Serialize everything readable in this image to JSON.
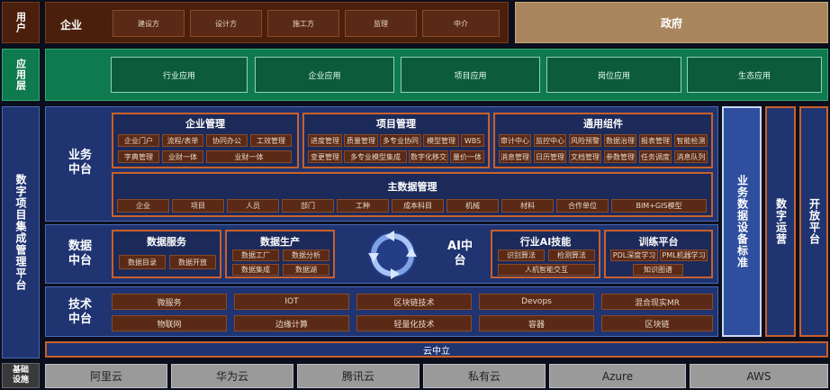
{
  "user_row": {
    "label": "用户",
    "enterprise_label": "企业",
    "roles": [
      "建设方",
      "设计方",
      "施工方",
      "监理",
      "中介"
    ],
    "government_label": "政府"
  },
  "app_row": {
    "label": "应用层",
    "items": [
      "行业应用",
      "企业应用",
      "项目应用",
      "岗位应用",
      "生态应用"
    ]
  },
  "left_label": "数字项目集成管理平台",
  "biz": {
    "label": "业务中台",
    "enterprise_mgmt": {
      "title": "企业管理",
      "cells": [
        "企业门户",
        "流程/表单",
        "协同办公",
        "工效管理",
        "字典管理",
        "业财一体",
        "业财一体"
      ]
    },
    "project_mgmt": {
      "title": "项目管理",
      "cells": [
        "进度管理",
        "质量管理",
        "多专业协同",
        "模型管理",
        "WBS",
        "变更管理",
        "多专业模型集成",
        "数字化移交",
        "量价一体"
      ]
    },
    "common": {
      "title": "通用组件",
      "cells": [
        "审计中心",
        "监控中心",
        "风险预警",
        "数据治理",
        "报表管理",
        "智能检测",
        "消息管理",
        "日历管理",
        "文档管理",
        "参数管理",
        "任务调度",
        "消息队列"
      ]
    },
    "master_data": {
      "title": "主数据管理",
      "cells": [
        "企业",
        "项目",
        "人员",
        "部门",
        "工种",
        "成本科目",
        "机械",
        "材料",
        "合作单位",
        "BIM+GIS模型"
      ]
    }
  },
  "data": {
    "label": "数据中台",
    "service": {
      "title": "数据服务",
      "cells": [
        "数据目录",
        "数据开放"
      ]
    },
    "production": {
      "title": "数据生产",
      "cells": [
        "数据工厂",
        "数据分析",
        "数据集成",
        "数据湖"
      ]
    },
    "ai_label": "AI中台",
    "ai_skill": {
      "title": "行业AI技能",
      "cells": [
        "识别算法",
        "检测算法",
        "人机智能交互"
      ]
    },
    "training": {
      "title": "训练平台",
      "cells": [
        "PDL深度学习",
        "PML机器学习",
        "知识图谱"
      ]
    }
  },
  "tech": {
    "label": "技术中台",
    "row1": [
      "微服务",
      "IOT",
      "区块链技术",
      "Devops",
      "混合现实MR"
    ],
    "row2": [
      "物联网",
      "边缘计算",
      "轻量化技术",
      "容器",
      "区块链"
    ]
  },
  "right_columns": [
    {
      "label": "业务数据设备标准"
    },
    {
      "label": "数字运营"
    },
    {
      "label": "开放平台"
    }
  ],
  "cloud_bar": "云中立",
  "infra": {
    "label": "基础设施",
    "items": [
      "阿里云",
      "华为云",
      "腾讯云",
      "私有云",
      "Azure",
      "AWS"
    ]
  },
  "colors": {
    "navy": "#1f3470",
    "brown": "#4a1f0c",
    "green": "#0f7a4e",
    "orange": "#c9602a",
    "gov": "#a9865d"
  }
}
